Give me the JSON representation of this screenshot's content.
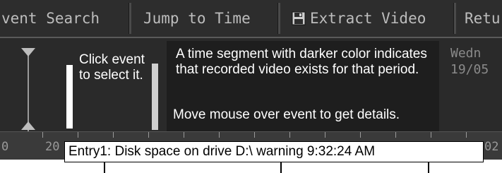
{
  "toolbar": {
    "event_search": "vent Search",
    "jump_to_time": "Jump to Time",
    "extract_video": "Extract Video",
    "return": "Retu"
  },
  "callouts": {
    "click_event": "Click event to select it.",
    "darker_segment": "A time segment with darker color indicates that recorded video exists for that period.",
    "hover_hint": "Move mouse over event to get details."
  },
  "date_panel": {
    "weekday": "Wedn",
    "date": "19/05"
  },
  "ruler": {
    "left_label_a": "0",
    "left_label_b": "20",
    "right_label": "02"
  },
  "tooltip": {
    "text": "Entry1: Disk space on drive D:\\ warning 9:32:24 AM"
  },
  "colors": {
    "toolbar_bg": "#2d2d2d",
    "panel_bg": "#2a2a2a",
    "recorded_segment": "#1e1e1e",
    "selected_event": "#ffffff"
  }
}
